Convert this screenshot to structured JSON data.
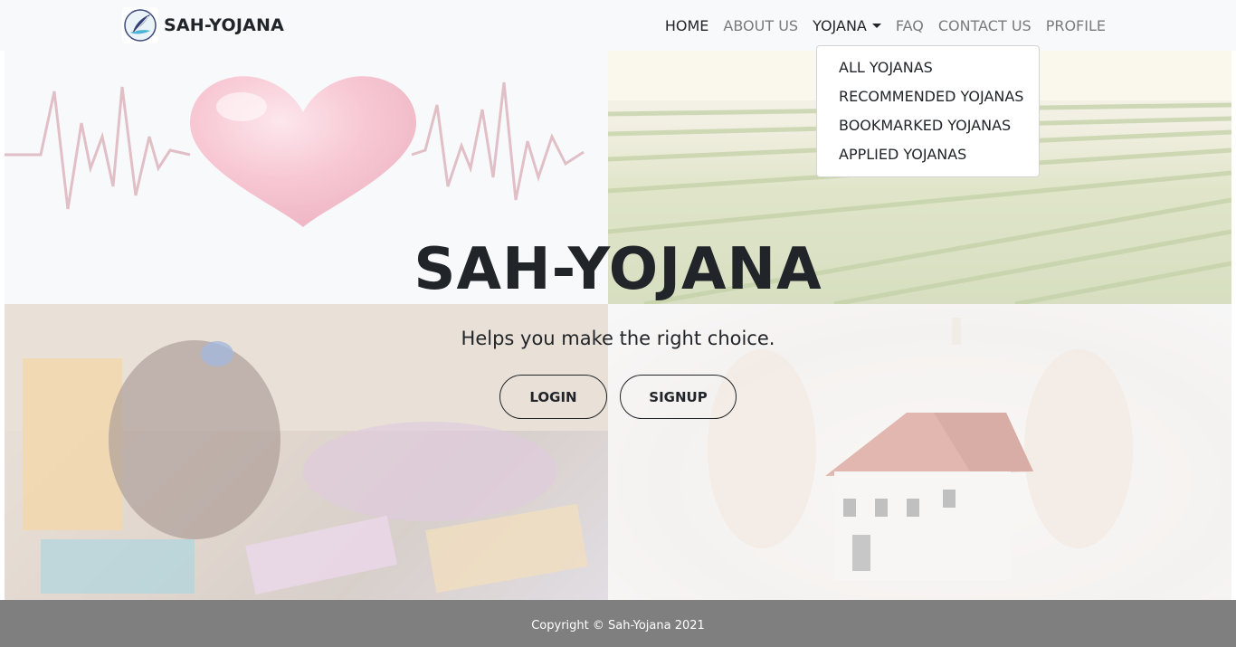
{
  "brand": {
    "name": "SAH-YOJANA",
    "logo_icon": "feather-quill-logo"
  },
  "nav": {
    "items": [
      {
        "label": "HOME",
        "state": "active"
      },
      {
        "label": "ABOUT US",
        "state": "normal"
      },
      {
        "label": "YOJANA",
        "state": "open",
        "has_dropdown": true
      },
      {
        "label": "FAQ",
        "state": "normal"
      },
      {
        "label": "CONTACT US",
        "state": "normal"
      },
      {
        "label": "PROFILE",
        "state": "normal"
      }
    ],
    "dropdown": {
      "items": [
        {
          "label": "ALL YOJANAS"
        },
        {
          "label": "RECOMMENDED YOJANAS"
        },
        {
          "label": "BOOKMARKED YOJANAS"
        },
        {
          "label": "APPLIED YOJANAS"
        }
      ]
    }
  },
  "hero": {
    "title": "SAH-YOJANA",
    "subtitle": "Helps you make the right choice.",
    "login_label": "LOGIN",
    "signup_label": "SIGNUP",
    "background_images": [
      "heartbeat-heart-image",
      "farm-field-image",
      "children-studying-image",
      "hands-protecting-house-image"
    ]
  },
  "footer": {
    "text": "Copyright © Sah-Yojana 2021"
  },
  "colors": {
    "navbar_bg": "#f8f9fa",
    "text_dark": "#212529",
    "nav_muted": "#7a7a7a",
    "footer_bg": "#7f7f7f",
    "heart_pink": "#ef8fa6"
  }
}
